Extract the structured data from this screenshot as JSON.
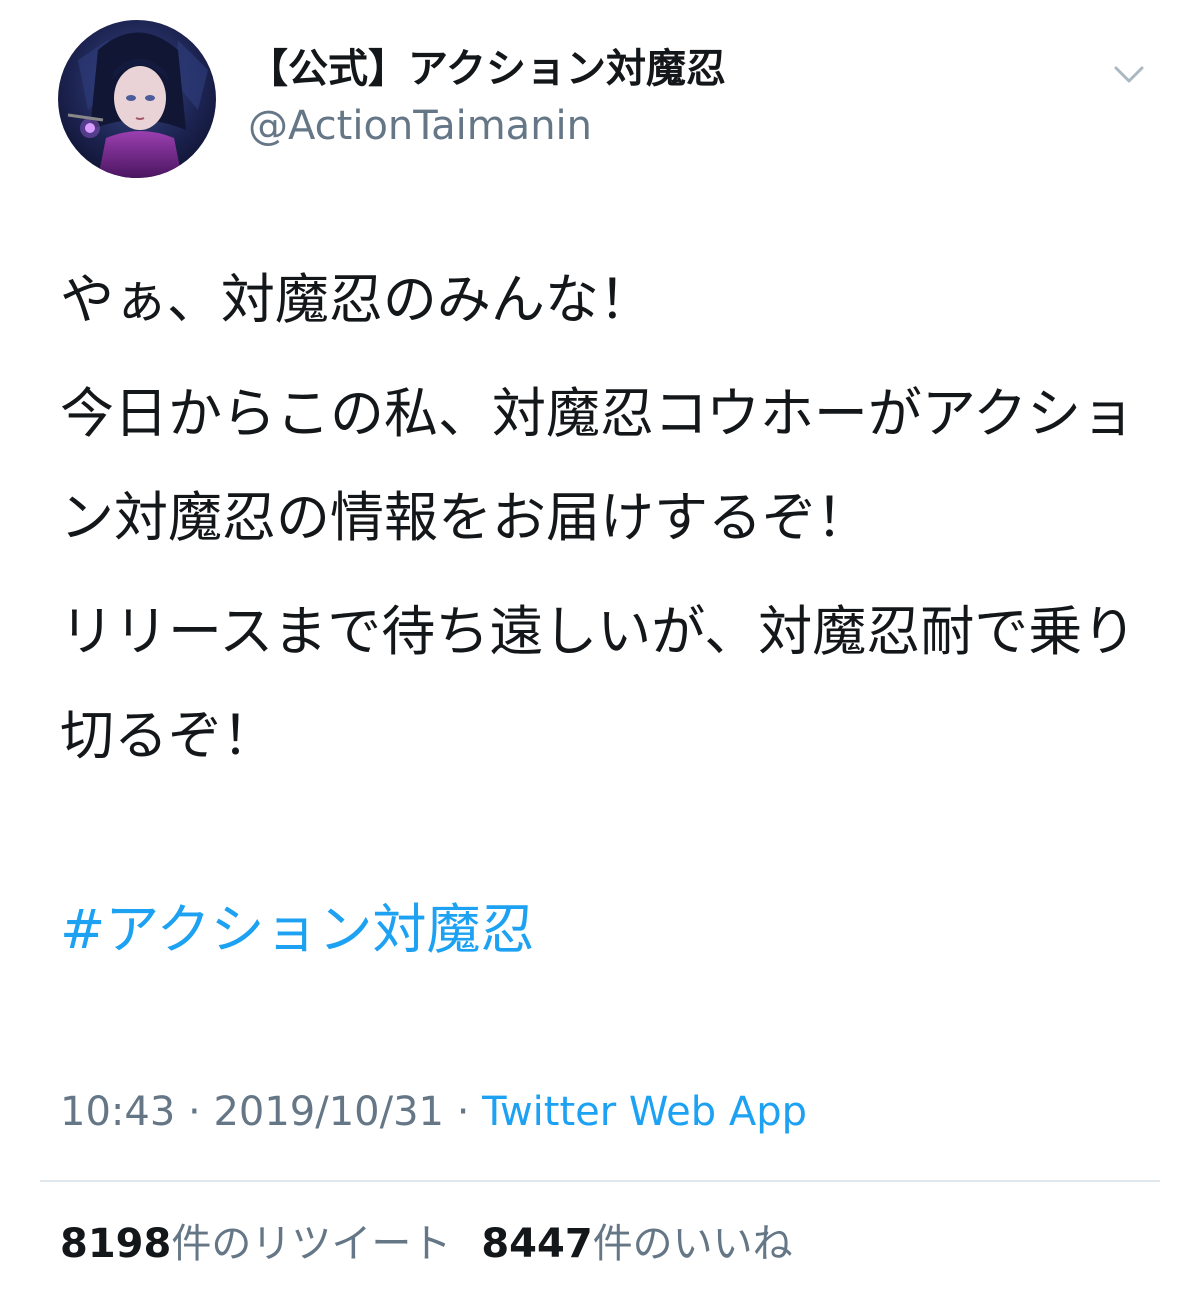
{
  "author": {
    "display_name": "【公式】アクション対魔忍",
    "handle": "@ActionTaimanin"
  },
  "tweet": {
    "paragraphs": [
      "やぁ、対魔忍のみんな！",
      "今日からこの私、対魔忍コウホーがアクション対魔忍の情報をお届けするぞ！",
      "リリースまで待ち遠しいが、対魔忍耐で乗り切るぞ！"
    ],
    "hashtag": "#アクション対魔忍"
  },
  "meta": {
    "time": "10:43",
    "separator": "·",
    "date": "2019/10/31",
    "source": "Twitter Web App"
  },
  "stats": {
    "retweet_count": "8198",
    "retweet_label": "件のリツイート",
    "like_count": "8447",
    "like_label": "件のいいね"
  },
  "icons": {
    "menu": "chevron-down-icon",
    "avatar": "anime-character-avatar"
  },
  "colors": {
    "link": "#1da1f2",
    "secondary_text": "#657786",
    "primary_text": "#14171a",
    "divider": "#e1e8ed"
  }
}
